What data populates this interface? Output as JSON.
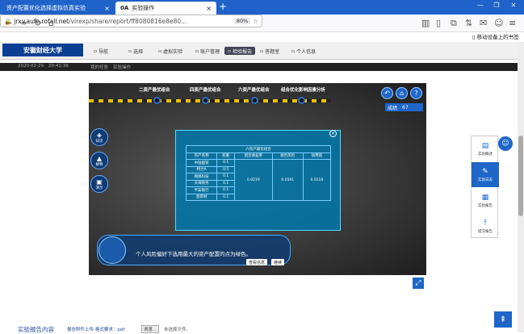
{
  "browser": {
    "tabs": [
      {
        "label": "资产配置优化选择虚拟仿真实验"
      },
      {
        "label": "实验操作",
        "badge": "0A"
      }
    ],
    "url_host": "jrxy.aufe.rofall.net",
    "url_path": "/virexp/share/report/ff8080816e8e80...",
    "zoom": "80%",
    "mobile_label": "移动设备上的书签"
  },
  "site": {
    "logo": "安徽财经大学",
    "menu": [
      "导航",
      "选择",
      "虚拟实验",
      "账户管理",
      "检验报告",
      "答题室",
      "个人信息"
    ],
    "active_menu": 4,
    "darkbar": {
      "date": "2020-02-29",
      "time": "20:41:36",
      "crumb1": "我的任务",
      "crumb2": "实验操作"
    }
  },
  "sim": {
    "steps": [
      "二资产最优组合",
      "四资产最优组合",
      "六资产最优组合",
      "组合优化影响因素分析"
    ],
    "score_label": "成绩",
    "score": "67",
    "side_buttons": [
      "知识",
      "解释",
      "演示"
    ],
    "panel": {
      "title": "六资产最优组合",
      "headers": [
        "资产名称",
        "权重",
        "组合收益率",
        "组合风险",
        "效用值"
      ],
      "rows": [
        [
          "中国国贸",
          "0.1"
        ],
        [
          "特力A",
          "0.5"
        ],
        [
          "网络科技",
          "0.1"
        ],
        [
          "天海防务",
          "0.1"
        ],
        [
          "平安银行",
          "0.1"
        ],
        [
          "金新材",
          "0.1"
        ]
      ],
      "merged": [
        "0.0219",
        "0.0591",
        "0.0218"
      ]
    },
    "dialog": {
      "text": "个人风险偏好下选用最大的资产配置的点为绿色。",
      "btn1": "查看信息",
      "btn2": "继续"
    }
  },
  "right_panel": [
    "实验概述",
    "实验日志",
    "实验报告",
    "提交报告"
  ],
  "bottom": {
    "report": "实验报告内容",
    "attach": "报告附件上传:格式要求：pdf",
    "choose": "浏览...",
    "nofile": "未选择文件。"
  }
}
